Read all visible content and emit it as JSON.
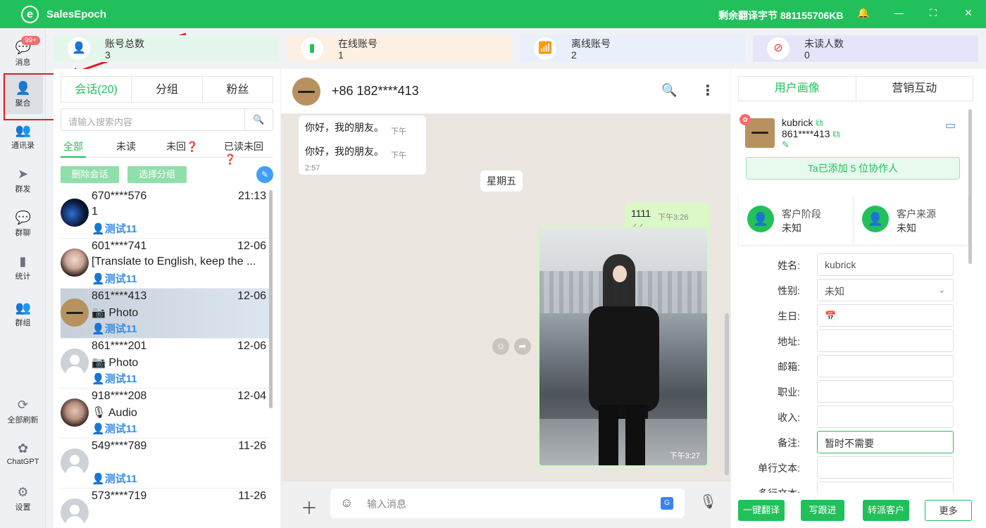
{
  "app": {
    "name": "SalesEpoch",
    "bytes_label": "剩余翻译字节 881155706KB"
  },
  "nav": {
    "messages_badge": "99+",
    "items": [
      "消息",
      "聚合",
      "通讯录",
      "群发",
      "群聊",
      "统计",
      "群组",
      "全部刷新",
      "ChatGPT",
      "设置"
    ]
  },
  "stats": [
    {
      "label": "账号总数",
      "value": "3"
    },
    {
      "label": "在线账号",
      "value": "1"
    },
    {
      "label": "离线账号",
      "value": "2"
    },
    {
      "label": "未读人数",
      "value": "0"
    }
  ],
  "conv": {
    "tabs": [
      "会话(20)",
      "分组",
      "粉丝"
    ],
    "search_placeholder": "请输入搜索内容",
    "filters": [
      "全部",
      "未读",
      "未回❓",
      "已读未回❓"
    ],
    "delete_btn": "删除会话",
    "group_btn": "选择分组",
    "items": [
      {
        "name": "670****576",
        "time": "21:13",
        "msg": "1",
        "tag": "测试11"
      },
      {
        "name": "601****741",
        "time": "12-06",
        "msg": "[Translate to English, keep the ...",
        "tag": "测试11"
      },
      {
        "name": "861****413",
        "time": "12-06",
        "msg": "Photo",
        "tag": "测试11"
      },
      {
        "name": "861****201",
        "time": "12-06",
        "msg": "Photo",
        "tag": "测试11"
      },
      {
        "name": "918****208",
        "time": "12-04",
        "msg": "Audio",
        "tag": "测试11"
      },
      {
        "name": "549****789",
        "time": "11-26",
        "msg": "",
        "tag": "测试11"
      },
      {
        "name": "573****719",
        "time": "11-26",
        "msg": "",
        "tag": ""
      }
    ]
  },
  "chat": {
    "contact": "+86 182****413",
    "messages": [
      {
        "text": "你好，我的朋友。",
        "time": "下午2:57"
      },
      {
        "text": "你好，我的朋友。",
        "time": "下午2:57"
      }
    ],
    "day": "星期五",
    "out_text": "1111",
    "out_time": "下午3:26",
    "img_time": "下午3:27",
    "input_placeholder": "输入消息"
  },
  "profile": {
    "tabs": [
      "用户画像",
      "营销互动"
    ],
    "name": "kubrick",
    "phone": "861****413",
    "collab": "Ta已添加 5 位协作人",
    "stage_label": "客户阶段",
    "stage_value": "未知",
    "source_label": "客户来源",
    "source_value": "未知",
    "fields": [
      {
        "label": "姓名:",
        "value": "kubrick"
      },
      {
        "label": "性别:",
        "value": "未知"
      },
      {
        "label": "生日:",
        "value": ""
      },
      {
        "label": "地址:",
        "value": ""
      },
      {
        "label": "邮箱:",
        "value": ""
      },
      {
        "label": "职业:",
        "value": ""
      },
      {
        "label": "收入:",
        "value": ""
      },
      {
        "label": "备注:",
        "value": "暂时不需要"
      },
      {
        "label": "单行文本:",
        "value": ""
      },
      {
        "label": "多行文本:",
        "value": ""
      }
    ],
    "buttons": [
      "一键翻译",
      "写跟进",
      "转派客户",
      "更多"
    ]
  }
}
